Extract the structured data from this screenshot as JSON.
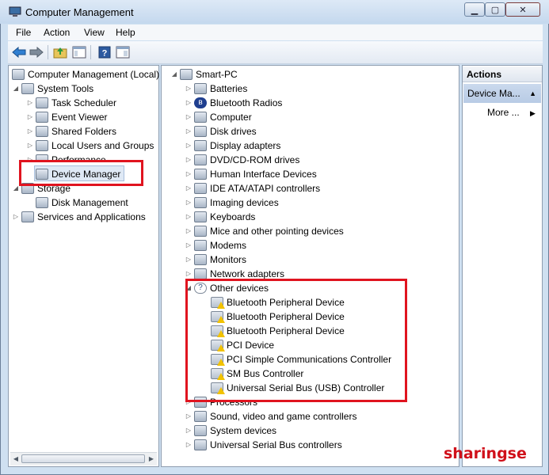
{
  "window": {
    "title": "Computer Management",
    "buttons": {
      "minimize": "▁",
      "maximize": "▢",
      "close": "✕"
    },
    "icon": "computer-management-icon"
  },
  "menu": [
    "File",
    "Action",
    "View",
    "Help"
  ],
  "toolbar": {
    "buttons": [
      "back-arrow-icon",
      "forward-arrow-icon",
      "up-folder-icon",
      "show-hide-tree-icon",
      "help-icon",
      "properties-icon"
    ]
  },
  "left_tree": {
    "root": "Computer Management (Local)",
    "items": [
      {
        "label": "System Tools",
        "icon": "tools-icon"
      },
      {
        "label": "Task Scheduler",
        "icon": "clock-icon"
      },
      {
        "label": "Event Viewer",
        "icon": "event-viewer-icon"
      },
      {
        "label": "Shared Folders",
        "icon": "shared-folder-icon"
      },
      {
        "label": "Local Users and Groups",
        "icon": "users-icon"
      },
      {
        "label": "Performance",
        "icon": "performance-icon"
      },
      {
        "label": "Device Manager",
        "icon": "device-manager-icon"
      },
      {
        "label": "Storage",
        "icon": "storage-icon"
      },
      {
        "label": "Disk Management",
        "icon": "disk-icon"
      },
      {
        "label": "Services and Applications",
        "icon": "services-icon"
      }
    ]
  },
  "device_tree": {
    "root": "Smart-PC",
    "categories": [
      "Batteries",
      "Bluetooth Radios",
      "Computer",
      "Disk drives",
      "Display adapters",
      "DVD/CD-ROM drives",
      "Human Interface Devices",
      "IDE ATA/ATAPI controllers",
      "Imaging devices",
      "Keyboards",
      "Mice and other pointing devices",
      "Modems",
      "Monitors",
      "Network adapters",
      "Other devices"
    ],
    "other_devices": [
      "Bluetooth Peripheral Device",
      "Bluetooth Peripheral Device",
      "Bluetooth Peripheral Device",
      "PCI Device",
      "PCI Simple Communications Controller",
      "SM Bus Controller",
      "Universal Serial Bus (USB) Controller"
    ],
    "after": [
      "Processors",
      "Sound, video and game controllers",
      "System devices",
      "Universal Serial Bus controllers"
    ]
  },
  "actions": {
    "header": "Actions",
    "section": "Device Ma...",
    "more": "More ..."
  },
  "watermark": "sharingse",
  "colors": {
    "highlight": "#e0141f",
    "watermark": "#d0101a"
  }
}
